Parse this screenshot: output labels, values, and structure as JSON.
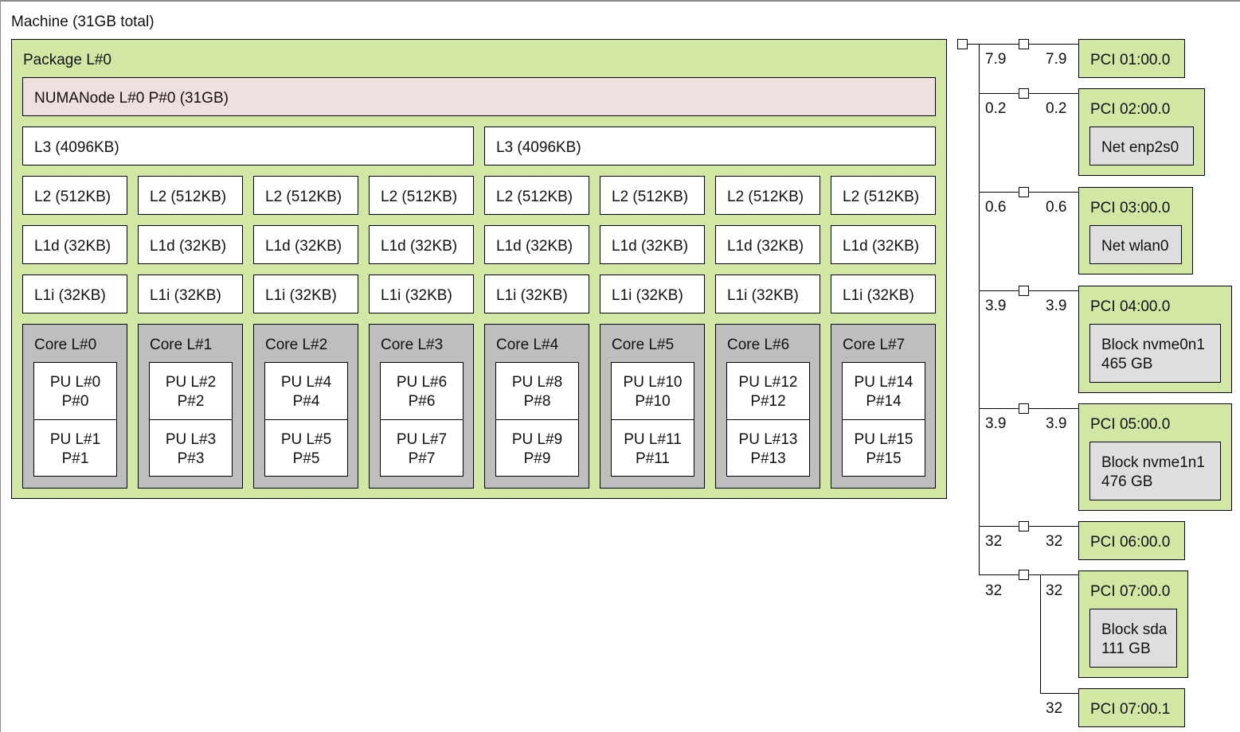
{
  "machine": {
    "title": "Machine (31GB total)"
  },
  "package": {
    "label": "Package L#0",
    "numa": "NUMANode L#0 P#0 (31GB)",
    "l3": [
      "L3 (4096KB)",
      "L3 (4096KB)"
    ],
    "l2": [
      "L2 (512KB)",
      "L2 (512KB)",
      "L2 (512KB)",
      "L2 (512KB)",
      "L2 (512KB)",
      "L2 (512KB)",
      "L2 (512KB)",
      "L2 (512KB)"
    ],
    "l1d": [
      "L1d (32KB)",
      "L1d (32KB)",
      "L1d (32KB)",
      "L1d (32KB)",
      "L1d (32KB)",
      "L1d (32KB)",
      "L1d (32KB)",
      "L1d (32KB)"
    ],
    "l1i": [
      "L1i (32KB)",
      "L1i (32KB)",
      "L1i (32KB)",
      "L1i (32KB)",
      "L1i (32KB)",
      "L1i (32KB)",
      "L1i (32KB)",
      "L1i (32KB)"
    ],
    "cores": [
      {
        "label": "Core L#0",
        "pu": [
          {
            "l": "PU L#0",
            "p": "P#0"
          },
          {
            "l": "PU L#1",
            "p": "P#1"
          }
        ]
      },
      {
        "label": "Core L#1",
        "pu": [
          {
            "l": "PU L#2",
            "p": "P#2"
          },
          {
            "l": "PU L#3",
            "p": "P#3"
          }
        ]
      },
      {
        "label": "Core L#2",
        "pu": [
          {
            "l": "PU L#4",
            "p": "P#4"
          },
          {
            "l": "PU L#5",
            "p": "P#5"
          }
        ]
      },
      {
        "label": "Core L#3",
        "pu": [
          {
            "l": "PU L#6",
            "p": "P#6"
          },
          {
            "l": "PU L#7",
            "p": "P#7"
          }
        ]
      },
      {
        "label": "Core L#4",
        "pu": [
          {
            "l": "PU L#8",
            "p": "P#8"
          },
          {
            "l": "PU L#9",
            "p": "P#9"
          }
        ]
      },
      {
        "label": "Core L#5",
        "pu": [
          {
            "l": "PU L#10",
            "p": "P#10"
          },
          {
            "l": "PU L#11",
            "p": "P#11"
          }
        ]
      },
      {
        "label": "Core L#6",
        "pu": [
          {
            "l": "PU L#12",
            "p": "P#12"
          },
          {
            "l": "PU L#13",
            "p": "P#13"
          }
        ]
      },
      {
        "label": "Core L#7",
        "pu": [
          {
            "l": "PU L#14",
            "p": "P#14"
          },
          {
            "l": "PU L#15",
            "p": "P#15"
          }
        ]
      }
    ]
  },
  "pci": [
    {
      "bw_left": "7.9",
      "bw_right": "7.9",
      "label": "PCI 01:00.0",
      "device": []
    },
    {
      "bw_left": "0.2",
      "bw_right": "0.2",
      "label": "PCI 02:00.0",
      "device": [
        "Net enp2s0"
      ]
    },
    {
      "bw_left": "0.6",
      "bw_right": "0.6",
      "label": "PCI 03:00.0",
      "device": [
        "Net wlan0"
      ]
    },
    {
      "bw_left": "3.9",
      "bw_right": "3.9",
      "label": "PCI 04:00.0",
      "device": [
        "Block nvme0n1",
        "465 GB"
      ]
    },
    {
      "bw_left": "3.9",
      "bw_right": "3.9",
      "label": "PCI 05:00.0",
      "device": [
        "Block nvme1n1",
        "476 GB"
      ]
    },
    {
      "bw_left": "32",
      "bw_right": "32",
      "label": "PCI 06:00.0",
      "device": []
    },
    {
      "bw_left": "32",
      "bw_right": "32",
      "label": "PCI 07:00.0",
      "device": [
        "Block sda",
        "111 GB"
      ]
    },
    {
      "bw_left": "",
      "bw_right": "32",
      "label": "PCI 07:00.1",
      "device": []
    }
  ],
  "colors": {
    "package": "#d2e7a4",
    "numa": "#efdfde",
    "core": "#bebebe",
    "cache": "#ffffff",
    "pci": "#d2e7a4",
    "device": "#dedede"
  }
}
